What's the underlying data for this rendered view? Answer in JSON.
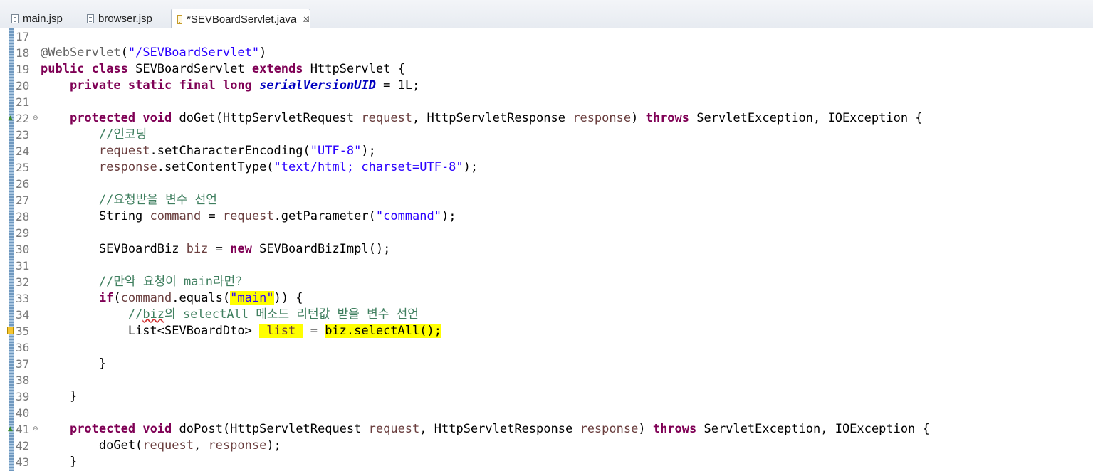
{
  "tabs": [
    {
      "label": "main.jsp",
      "icon": "jsp-file-icon"
    },
    {
      "label": "browser.jsp",
      "icon": "jsp-file-icon"
    },
    {
      "label": "*SEVBoardServlet.java",
      "icon": "java-file-icon",
      "active": true,
      "close": "☒"
    }
  ],
  "lines": [
    {
      "n": "17",
      "segs": []
    },
    {
      "n": "18",
      "segs": [
        [
          "an",
          "@WebServlet"
        ],
        [
          "",
          "("
        ],
        [
          "str",
          "\"/SEVBoardServlet\""
        ],
        [
          "",
          ")"
        ]
      ]
    },
    {
      "n": "19",
      "segs": [
        [
          "kw",
          "public"
        ],
        [
          "",
          " "
        ],
        [
          "kw",
          "class"
        ],
        [
          "",
          " SEVBoardServlet "
        ],
        [
          "kw",
          "extends"
        ],
        [
          "",
          " HttpServlet {"
        ]
      ]
    },
    {
      "n": "20",
      "segs": [
        [
          "",
          "    "
        ],
        [
          "kw",
          "private"
        ],
        [
          "",
          " "
        ],
        [
          "kw",
          "static"
        ],
        [
          "",
          " "
        ],
        [
          "kw",
          "final"
        ],
        [
          "",
          " "
        ],
        [
          "kw",
          "long"
        ],
        [
          "",
          " "
        ],
        [
          "fld",
          "serialVersionUID"
        ],
        [
          "",
          " = 1L;"
        ]
      ]
    },
    {
      "n": "21",
      "segs": []
    },
    {
      "n": "22",
      "segs": [
        [
          "",
          "    "
        ],
        [
          "kw",
          "protected"
        ],
        [
          "",
          " "
        ],
        [
          "kw",
          "void"
        ],
        [
          "",
          " doGet(HttpServletRequest "
        ],
        [
          "var",
          "request"
        ],
        [
          "",
          ", HttpServletResponse "
        ],
        [
          "var",
          "response"
        ],
        [
          "",
          ") "
        ],
        [
          "kw",
          "throws"
        ],
        [
          "",
          " ServletException, IOException {"
        ]
      ]
    },
    {
      "n": "23",
      "segs": [
        [
          "",
          "        "
        ],
        [
          "cm",
          "//인코딩"
        ]
      ]
    },
    {
      "n": "24",
      "segs": [
        [
          "",
          "        "
        ],
        [
          "var",
          "request"
        ],
        [
          "",
          ".setCharacterEncoding("
        ],
        [
          "str",
          "\"UTF-8\""
        ],
        [
          "",
          ");"
        ]
      ]
    },
    {
      "n": "25",
      "segs": [
        [
          "",
          "        "
        ],
        [
          "var",
          "response"
        ],
        [
          "",
          ".setContentType("
        ],
        [
          "str",
          "\"text/html; charset=UTF-8\""
        ],
        [
          "",
          ");"
        ]
      ]
    },
    {
      "n": "26",
      "segs": []
    },
    {
      "n": "27",
      "segs": [
        [
          "",
          "        "
        ],
        [
          "cm",
          "//요청받을 변수 선언"
        ]
      ]
    },
    {
      "n": "28",
      "segs": [
        [
          "",
          "        String "
        ],
        [
          "var",
          "command"
        ],
        [
          "",
          " = "
        ],
        [
          "var",
          "request"
        ],
        [
          "",
          ".getParameter("
        ],
        [
          "str",
          "\"command\""
        ],
        [
          "",
          ");"
        ]
      ]
    },
    {
      "n": "29",
      "segs": []
    },
    {
      "n": "30",
      "segs": [
        [
          "",
          "        SEVBoardBiz "
        ],
        [
          "var",
          "biz"
        ],
        [
          "",
          " = "
        ],
        [
          "kw",
          "new"
        ],
        [
          "",
          " SEVBoardBizImpl();"
        ]
      ]
    },
    {
      "n": "31",
      "segs": []
    },
    {
      "n": "32",
      "segs": [
        [
          "",
          "        "
        ],
        [
          "cm",
          "//만약 요청이 main라면?"
        ]
      ]
    },
    {
      "n": "33",
      "segs": [
        [
          "",
          "        "
        ],
        [
          "kw",
          "if"
        ],
        [
          "",
          "("
        ],
        [
          "var",
          "command"
        ],
        [
          "",
          ".equals("
        ],
        [
          "str hl",
          "\"main\""
        ],
        [
          "",
          ")) {"
        ]
      ]
    },
    {
      "n": "34",
      "segs": [
        [
          "",
          "            "
        ],
        [
          "cm",
          "//"
        ],
        [
          "cm squig",
          "biz"
        ],
        [
          "cm",
          "의 selectAll 메소드 리턴값 받을 변수 선언"
        ]
      ]
    },
    {
      "n": "35",
      "segs": [
        [
          "",
          "            List<SEVBoardDto> "
        ],
        [
          "var hl",
          " list "
        ],
        [
          "",
          " = "
        ],
        [
          "hl",
          "biz.selectAll();"
        ]
      ]
    },
    {
      "n": "36",
      "segs": []
    },
    {
      "n": "37",
      "segs": [
        [
          "",
          "        }"
        ]
      ]
    },
    {
      "n": "38",
      "segs": []
    },
    {
      "n": "39",
      "segs": [
        [
          "",
          "    }"
        ]
      ]
    },
    {
      "n": "40",
      "segs": []
    },
    {
      "n": "41",
      "segs": [
        [
          "",
          "    "
        ],
        [
          "kw",
          "protected"
        ],
        [
          "",
          " "
        ],
        [
          "kw",
          "void"
        ],
        [
          "",
          " doPost(HttpServletRequest "
        ],
        [
          "var",
          "request"
        ],
        [
          "",
          ", HttpServletResponse "
        ],
        [
          "var",
          "response"
        ],
        [
          "",
          ") "
        ],
        [
          "kw",
          "throws"
        ],
        [
          "",
          " ServletException, IOException {"
        ]
      ]
    },
    {
      "n": "42",
      "segs": [
        [
          "",
          "        doGet("
        ],
        [
          "var",
          "request"
        ],
        [
          "",
          ", "
        ],
        [
          "var",
          "response"
        ],
        [
          "",
          ");"
        ]
      ]
    },
    {
      "n": "43",
      "segs": [
        [
          "",
          "    }"
        ]
      ]
    }
  ]
}
